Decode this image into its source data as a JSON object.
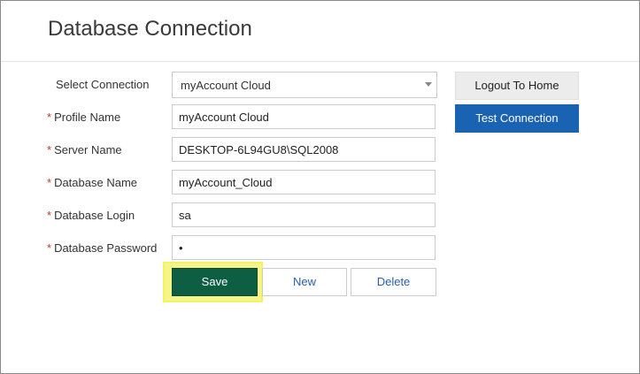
{
  "page": {
    "title": "Database Connection"
  },
  "form": {
    "select_connection": {
      "label": "Select Connection",
      "value": "myAccount Cloud"
    },
    "profile_name": {
      "label": "Profile Name",
      "required_mark": "*",
      "value": "myAccount Cloud"
    },
    "server_name": {
      "label": "Server Name",
      "required_mark": "*",
      "value": "DESKTOP-6L94GU8\\SQL2008"
    },
    "database_name": {
      "label": "Database Name",
      "required_mark": "*",
      "value": "myAccount_Cloud"
    },
    "database_login": {
      "label": "Database Login",
      "required_mark": "*",
      "value": "sa"
    },
    "database_password": {
      "label": "Database Password",
      "required_mark": "*",
      "value": "•"
    }
  },
  "buttons": {
    "logout": "Logout To Home",
    "test_connection": "Test Connection",
    "save": "Save",
    "new": "New",
    "delete": "Delete"
  },
  "colors": {
    "primary_blue": "#1a63b3",
    "save_green": "#0d5e43",
    "highlight_yellow": "#f6f58a",
    "required_red": "#c0392b"
  }
}
